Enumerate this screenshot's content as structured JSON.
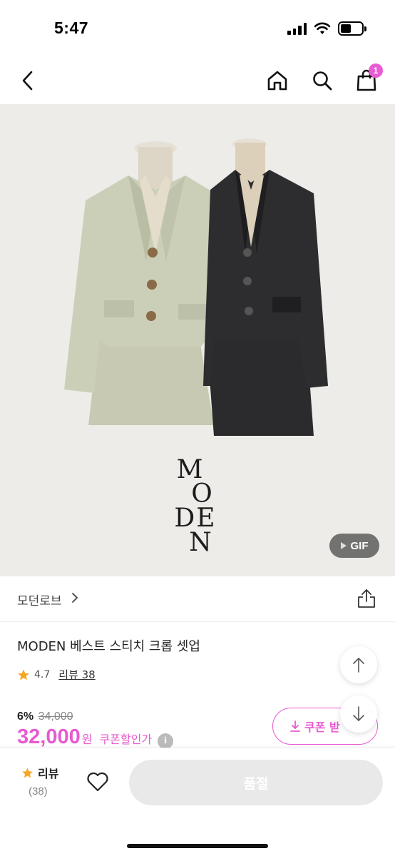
{
  "status_bar": {
    "time": "5:47"
  },
  "nav": {
    "cart_count": "1"
  },
  "product_image": {
    "brand_logo_letters": [
      "M",
      "O",
      "DE",
      "N"
    ],
    "gif_label": "GIF",
    "jacket_colors": [
      "#c9cdb6",
      "#2a2a2c"
    ]
  },
  "brand": {
    "name": "모던로브"
  },
  "product": {
    "title": "MODEN 베스트 스티치 크롭 셋업",
    "rating": "4.7",
    "review_label": "리뷰 38",
    "discount_rate": "6%",
    "original_price": "34,000",
    "sale_price": "32,000",
    "currency": "원",
    "coupon_price_label": "쿠폰할인가",
    "coupon_button_label": "쿠폰 받",
    "info_icon": "i"
  },
  "bottom_bar": {
    "review_label": "리뷰",
    "review_count": "(38)",
    "soldout_label": "품절"
  },
  "colors": {
    "accent": "#e85ad1",
    "star": "#f5a623"
  }
}
